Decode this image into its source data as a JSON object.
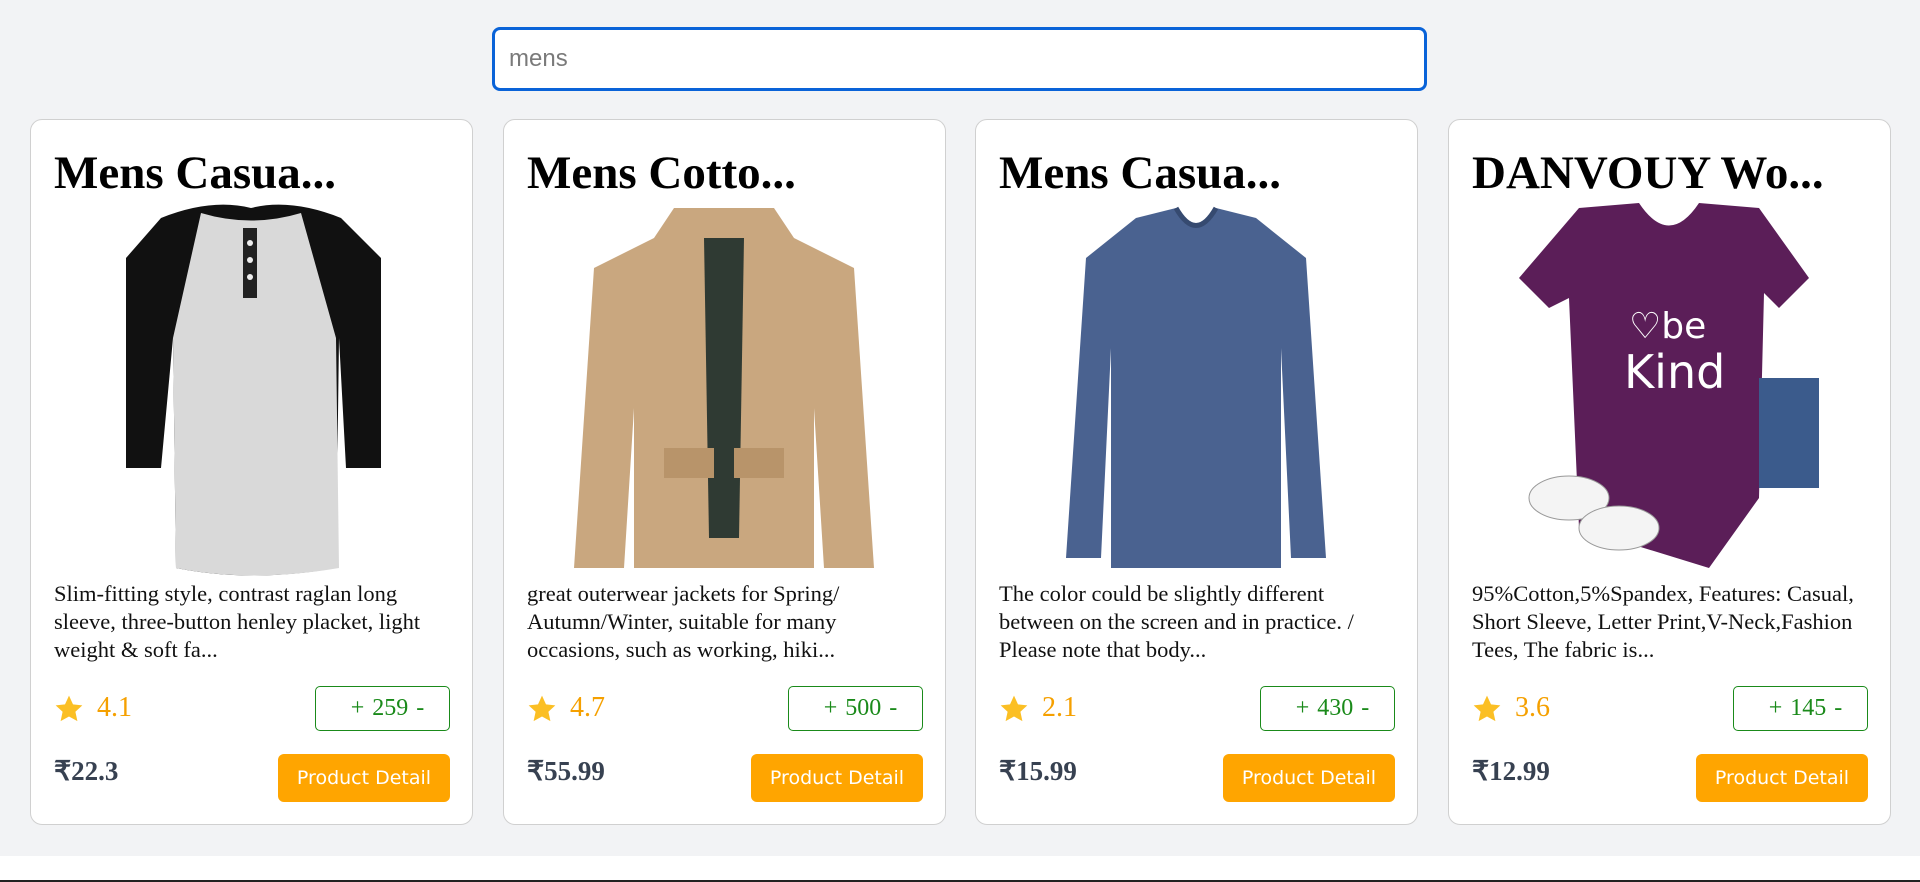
{
  "search": {
    "value": "mens"
  },
  "products": [
    {
      "title": "Mens Casua...",
      "description": "Slim-fitting style, contrast raglan long sleeve, three-button henley placket, light weight & soft fa...",
      "rating": "4.1",
      "plus": "+",
      "count": "259",
      "minus": "-",
      "price": "₹22.3",
      "button": "Product Detail",
      "image": "henley-shirt"
    },
    {
      "title": "Mens Cotto...",
      "description": "great outerwear jackets for Spring/ Autumn/Winter, suitable for many occasions, such as working, hiki...",
      "rating": "4.7",
      "plus": "+",
      "count": "500",
      "minus": "-",
      "price": "₹55.99",
      "button": "Product Detail",
      "image": "cotton-jacket"
    },
    {
      "title": "Mens Casua...",
      "description": "The color could be slightly different between on the screen and in practice. / Please note that body...",
      "rating": "2.1",
      "plus": "+",
      "count": "430",
      "minus": "-",
      "price": "₹15.99",
      "button": "Product Detail",
      "image": "blue-longsleeve"
    },
    {
      "title": "DANVOUY Wo...",
      "description": "95%Cotton,5%Spandex, Features: Casual, Short Sleeve, Letter Print,V-Neck,Fashion Tees, The fabric is...",
      "rating": "3.6",
      "plus": "+",
      "count": "145",
      "minus": "-",
      "price": "₹12.99",
      "button": "Product Detail",
      "image": "be-kind-tee"
    }
  ],
  "colors": {
    "accent": "#ffa500",
    "rating": "#f5a000",
    "qty": "#1a8a1a",
    "focus": "#0a63d8"
  }
}
